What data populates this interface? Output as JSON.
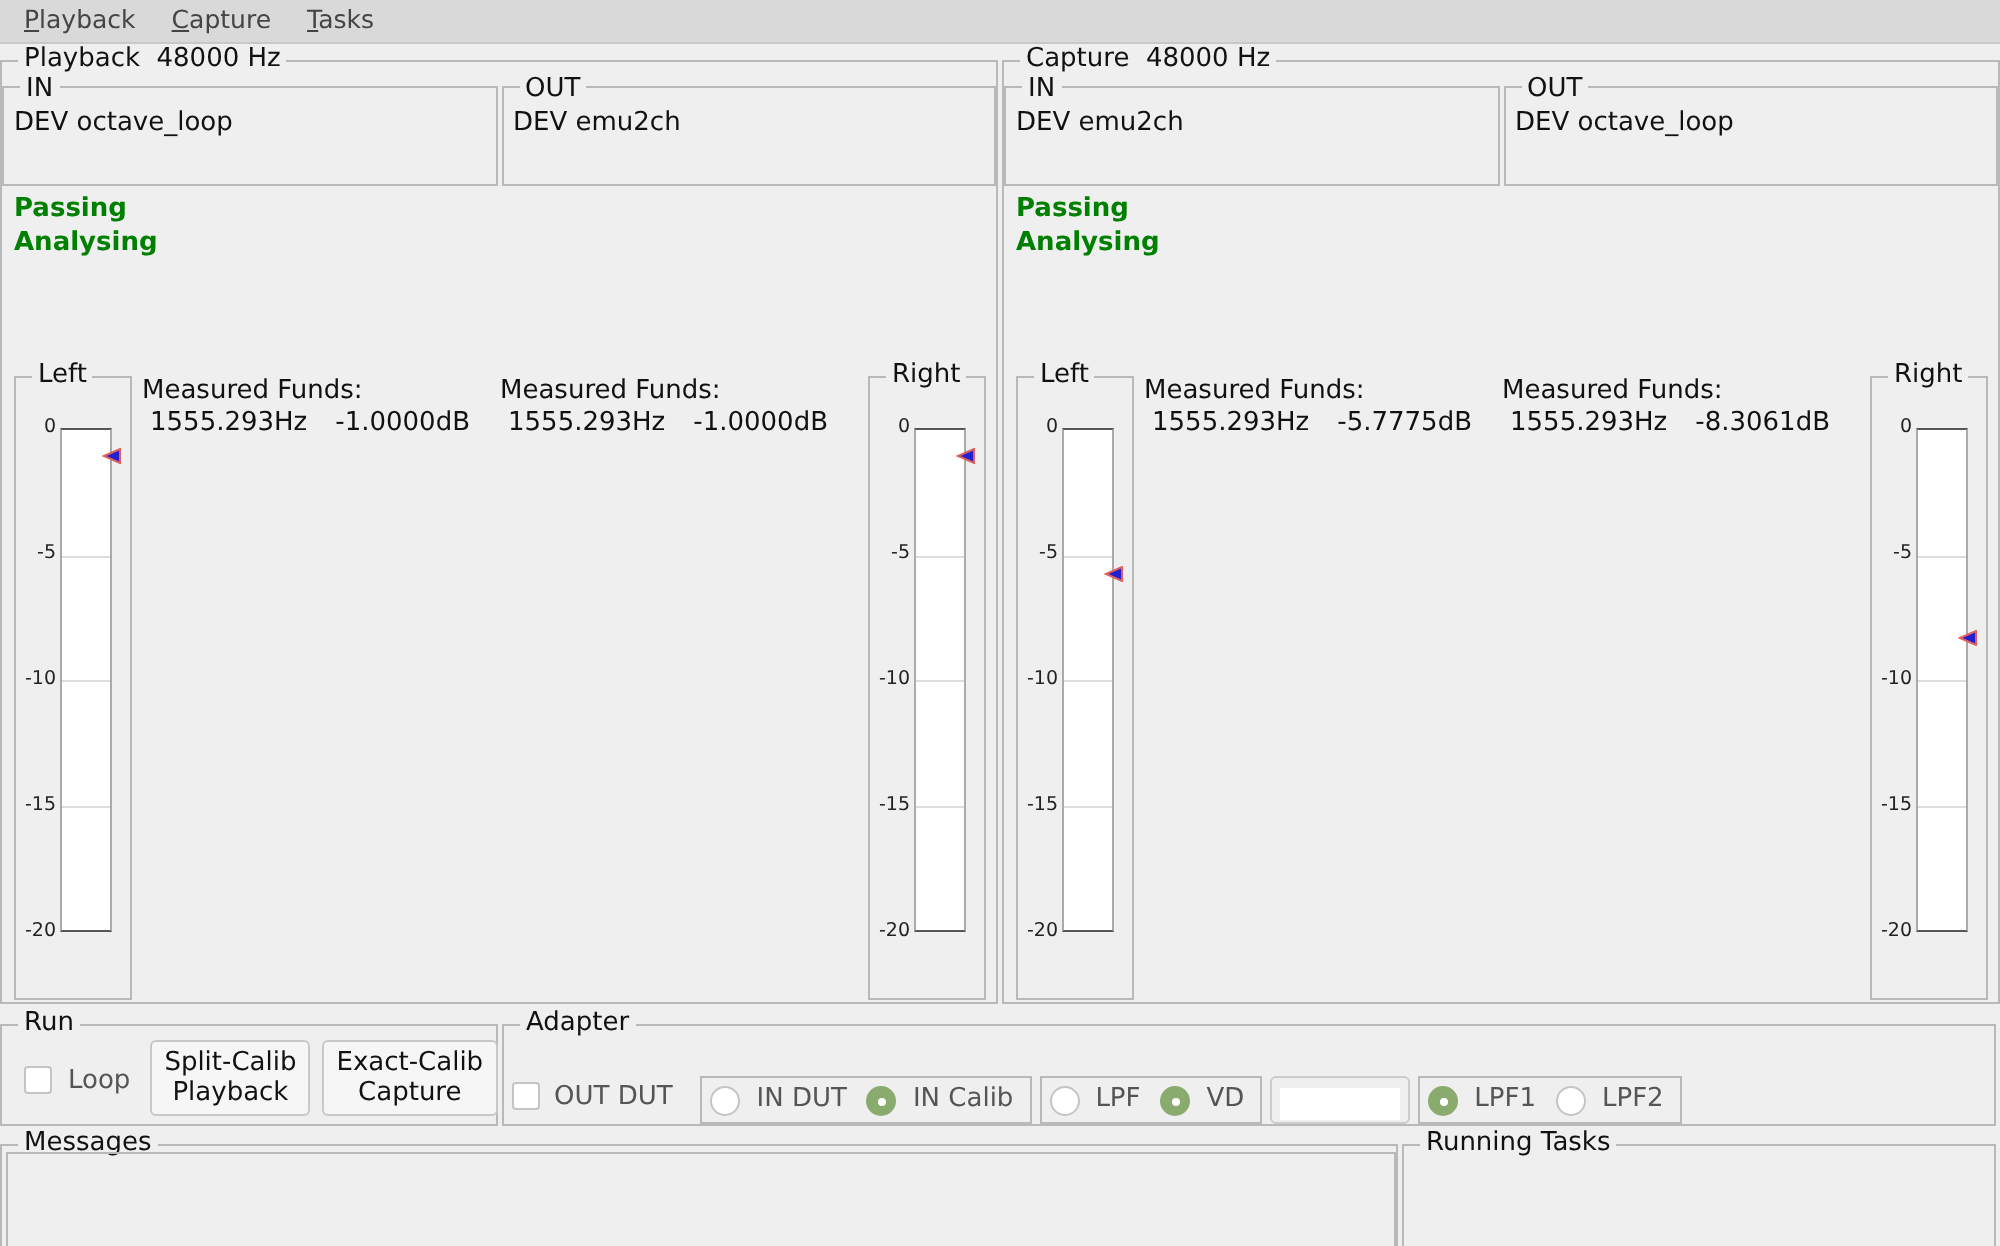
{
  "menu": [
    {
      "label": "Playback"
    },
    {
      "label": "Capture"
    },
    {
      "label": "Tasks"
    }
  ],
  "panels": [
    {
      "title": "Playback  48000 Hz",
      "in": {
        "label": "IN",
        "device": "DEV octave_loop"
      },
      "out": {
        "label": "OUT",
        "device": "DEV emu2ch"
      },
      "status": [
        "Passing",
        "Analysing"
      ],
      "meters": [
        {
          "label": "Left",
          "ticks": [
            "0",
            "-5",
            "-10",
            "-15",
            "-20"
          ],
          "level": 0.95
        },
        {
          "label": "Right",
          "ticks": [
            "0",
            "-5",
            "-10",
            "-15",
            "-20"
          ],
          "level": 0.95
        }
      ],
      "measurements": [
        {
          "heading": "Measured Funds:",
          "frequency": "1555.293Hz",
          "amplitude": "-1.0000dB"
        },
        {
          "heading": "Measured Funds:",
          "frequency": "1555.293Hz",
          "amplitude": "-1.0000dB"
        }
      ]
    },
    {
      "title": "Capture  48000 Hz",
      "in": {
        "label": "IN",
        "device": "DEV emu2ch"
      },
      "out": {
        "label": "OUT",
        "device": "DEV octave_loop"
      },
      "status": [
        "Passing",
        "Analysing"
      ],
      "meters": [
        {
          "label": "Left",
          "ticks": [
            "0",
            "-5",
            "-10",
            "-15",
            "-20"
          ],
          "level": 0.711
        },
        {
          "label": "Right",
          "ticks": [
            "0",
            "-5",
            "-10",
            "-15",
            "-20"
          ],
          "level": 0.585
        }
      ],
      "measurements": [
        {
          "heading": "Measured Funds:",
          "frequency": "1555.293Hz",
          "amplitude": "-5.7775dB"
        },
        {
          "heading": "Measured Funds:",
          "frequency": "1555.293Hz",
          "amplitude": "-8.3061dB"
        }
      ]
    }
  ],
  "run": {
    "title": "Run",
    "loop": {
      "label": "Loop",
      "checked": false
    },
    "buttons": [
      "Split-Calib\nPlayback",
      "Exact-Calib\nCapture"
    ]
  },
  "adapter": {
    "title": "Adapter",
    "out_dut": {
      "label": "OUT DUT",
      "checked": false
    },
    "controls": [
      {
        "kind": "radio_group",
        "options": [
          {
            "label": "IN DUT",
            "selected": false
          },
          {
            "label": "IN Calib",
            "selected": true
          }
        ]
      },
      {
        "kind": "radio_group",
        "options": [
          {
            "label": "LPF",
            "selected": false
          },
          {
            "label": "VD",
            "selected": true
          }
        ]
      },
      {
        "kind": "field"
      },
      {
        "kind": "radio_group",
        "options": [
          {
            "label": "LPF1",
            "selected": true
          },
          {
            "label": "LPF2",
            "selected": false
          }
        ]
      }
    ]
  },
  "messages": {
    "title": "Messages"
  },
  "running_tasks": {
    "title": "Running Tasks"
  }
}
